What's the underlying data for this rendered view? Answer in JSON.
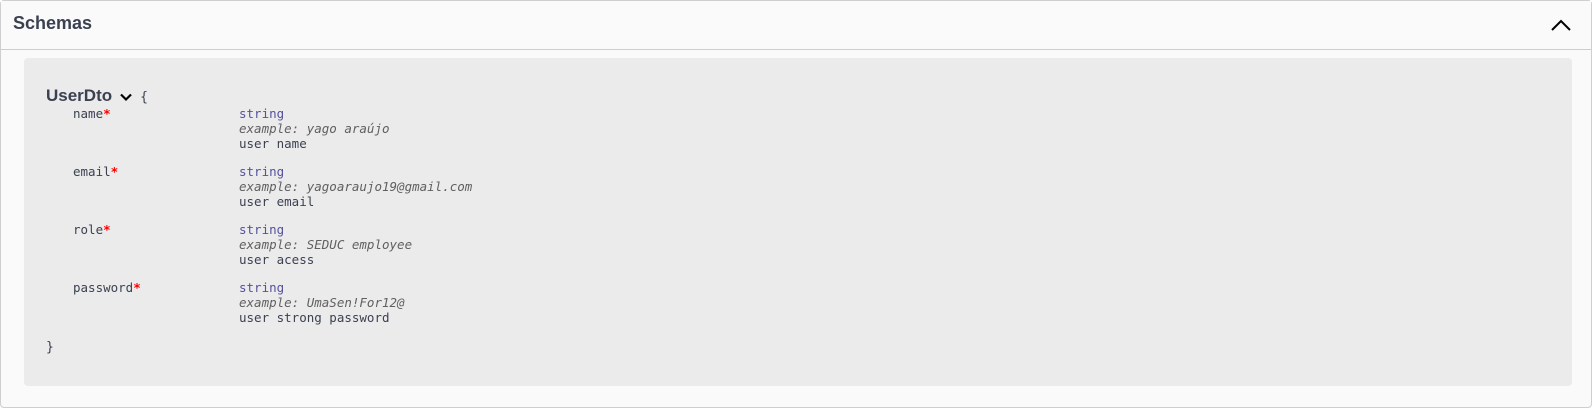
{
  "section": {
    "title": "Schemas",
    "toggle_icon": "chevron-up-icon"
  },
  "model": {
    "name": "UserDto",
    "expand_icon": "chevron-down-icon",
    "open_brace": "{",
    "close_brace": "}",
    "required_marker": "*",
    "properties": [
      {
        "name": "name",
        "type": "string",
        "example": "example: yago araújo",
        "description": "user name"
      },
      {
        "name": "email",
        "type": "string",
        "example": "example: yagoaraujo19@gmail.com",
        "description": "user email"
      },
      {
        "name": "role",
        "type": "string",
        "example": "example: SEDUC employee",
        "description": "user acess"
      },
      {
        "name": "password",
        "type": "string",
        "example": "example: UmaSen!For12@",
        "description": "user strong password"
      }
    ]
  }
}
